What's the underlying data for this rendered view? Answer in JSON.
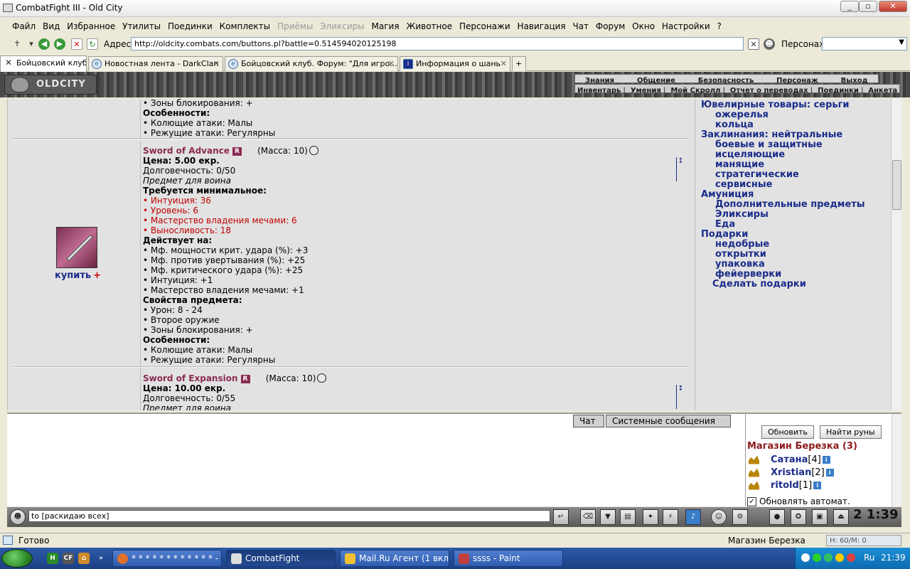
{
  "window": {
    "title": "CombatFight III - Old City"
  },
  "menu": [
    "Файл",
    "Вид",
    "Избранное",
    "Утилиты",
    "Поединки",
    "Комплекты",
    "Приёмы",
    "Эликсиры",
    "Магия",
    "Животное",
    "Персонажи",
    "Навигация",
    "Чат",
    "Форум",
    "Окно",
    "Настройки",
    "?"
  ],
  "address": {
    "label": "Адрес:",
    "url": "http://oldcity.combats.com/buttons.pl?battle=0.514594020125198",
    "persona_label": "Персонаж:"
  },
  "tabs": [
    {
      "label": "Бойцовский клуб"
    },
    {
      "label": "Новостная лента - DarkClan"
    },
    {
      "label": "Бойцовский клуб. Форум: \"Для игро..."
    },
    {
      "label": "Информация о шань"
    }
  ],
  "game": {
    "logo": "OLDCITY",
    "topnav": [
      "Знания",
      "Общение",
      "Безопасность",
      "Персонаж",
      "Выход"
    ],
    "subnav": [
      "Инвентарь",
      "Умения",
      "Мой Скролл",
      "Отчет о переводах",
      "Поединки",
      "Анкета"
    ]
  },
  "items": {
    "prev_tail": [
      "• Зоны блокирования: +",
      "Особенности:",
      "• Колющие атаки: Малы",
      "• Режущие атаки: Регулярны"
    ],
    "sword1": {
      "name": "Sword of Advance",
      "badge": "R",
      "mass": "(Масса: 10)",
      "price": "Цена: 5.00 екр.",
      "durability": "Долговечность: 0/50",
      "for": "Предмет для воина",
      "req_title": "Требуется минимальное:",
      "reqs": [
        "• Интуиция: 36",
        "• Уровень: 6",
        "• Мастерство владения мечами: 6",
        "• Выносливость: 18"
      ],
      "acts_title": "Действует на:",
      "acts": [
        "• Мф. мощности крит. удара (%): +3",
        "• Мф. против увертывания (%): +25",
        "• Мф. критического удара (%): +25",
        "• Интуиция: +1",
        "• Мастерство владения мечами: +1"
      ],
      "props_title": "Свойства предмета:",
      "props": [
        "• Урон: 8 - 24",
        "• Второе оружие",
        "• Зоны блокирования: +"
      ],
      "feat_title": "Особенности:",
      "feats": [
        "• Колющие атаки: Малы",
        "• Режущие атаки: Регулярны"
      ],
      "buy": "купить",
      "plus": "+"
    },
    "sword2": {
      "name": "Sword of Expansion",
      "badge": "R",
      "mass": "(Масса: 10)",
      "price": "Цена: 10.00 екр.",
      "durability": "Долговечность: 0/55",
      "for": "Предмет для воина"
    }
  },
  "categories": {
    "l1": "Ювелирные товары: серьги",
    "l2": "ожерелья",
    "l3": "кольца",
    "l4": "Заклинания: нейтральные",
    "l5": "боевые и защитные",
    "l6": "исцеляющие",
    "l7": "манящие",
    "l8": "стратегические",
    "l9": "сервисные",
    "l10": "Амуниция",
    "l11": "Дополнительные предметы",
    "l12": "Эликсиры",
    "l13": "Еда",
    "l14": "Подарки",
    "l15": "недобрые",
    "l16": "открытки",
    "l17": "упаковка",
    "l18": "фейерверки",
    "l19": "Сделать подарки"
  },
  "chat": {
    "tabs": [
      "Чат",
      "Системные сообщения"
    ],
    "input": "to [раскидаю всех]",
    "clock": "2 1:39"
  },
  "online": {
    "refresh": "Обновить",
    "find_runes": "Найти руны",
    "shop": "Магазин Березка (3)",
    "users": [
      {
        "name": "Сатана",
        "level": "[4]"
      },
      {
        "name": "Xristian",
        "level": "[2]"
      },
      {
        "name": "ritold",
        "level": "[1]"
      }
    ],
    "auto": "Обновлять автомат.",
    "auto_check": "✓"
  },
  "status": {
    "text": "Готово",
    "location": "Магазин Березка",
    "hp": "H: 60/M: 0"
  },
  "taskbar": {
    "ql_label": "CF",
    "tasks": [
      {
        "label": "* * * * * * * * * * * * - ..."
      },
      {
        "label": "CombatFight"
      },
      {
        "label": "Mail.Ru Агент (1 вкл..."
      },
      {
        "label": "ssss - Paint"
      }
    ],
    "lang": "Ru",
    "time": "21:39"
  }
}
